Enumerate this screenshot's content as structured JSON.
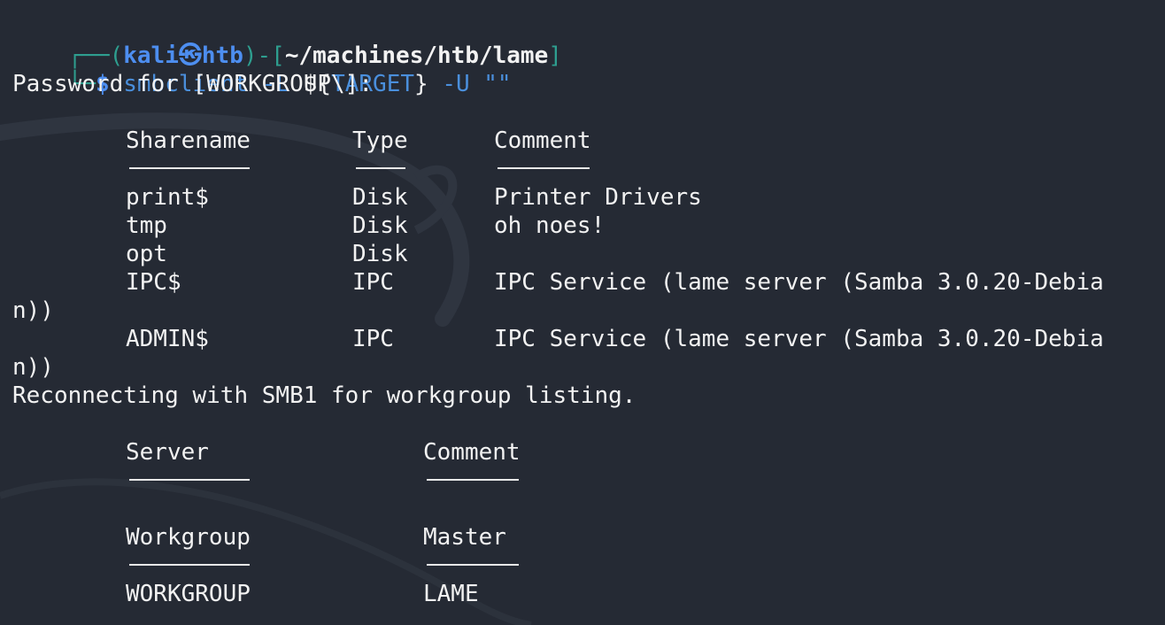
{
  "prompt": {
    "open_paren": "(",
    "user": "kali",
    "at_icon": "kali-dragon-icon",
    "host": "htb",
    "close_paren": ")-[",
    "path": "~/machines/htb/lame",
    "close_bracket": "]",
    "dollar": "$",
    "command_name": "smbclient",
    "command_flag_l": "-L",
    "var_open": "${",
    "var_name": "TARGET",
    "var_close": "}",
    "command_flag_u": "-U",
    "command_user_arg": "\"\""
  },
  "password_prompt": "Password for [WORKGROUP\\]:",
  "share_table": {
    "headers": [
      "Sharename",
      "Type",
      "Comment"
    ],
    "rows": [
      {
        "name": "print$",
        "type": "Disk",
        "comment": "Printer Drivers",
        "wrap": ""
      },
      {
        "name": "tmp",
        "type": "Disk",
        "comment": "oh noes!",
        "wrap": ""
      },
      {
        "name": "opt",
        "type": "Disk",
        "comment": "",
        "wrap": ""
      },
      {
        "name": "IPC$",
        "type": "IPC",
        "comment": "IPC Service (lame server (Samba 3.0.20-Debia",
        "wrap": "n))"
      },
      {
        "name": "ADMIN$",
        "type": "IPC",
        "comment": "IPC Service (lame server (Samba 3.0.20-Debia",
        "wrap": "n))"
      }
    ]
  },
  "reconnect_message": "Reconnecting with SMB1 for workgroup listing.",
  "server_table": {
    "headers": [
      "Server",
      "Comment"
    ]
  },
  "workgroup_table": {
    "headers": [
      "Workgroup",
      "Master"
    ],
    "rows": [
      {
        "workgroup": "WORKGROUP",
        "master": "LAME"
      }
    ]
  },
  "colors": {
    "background": "#252a34",
    "prompt_green": "#2e9e8f",
    "prompt_blue": "#4d8ef0",
    "text": "#f2f2f2"
  }
}
